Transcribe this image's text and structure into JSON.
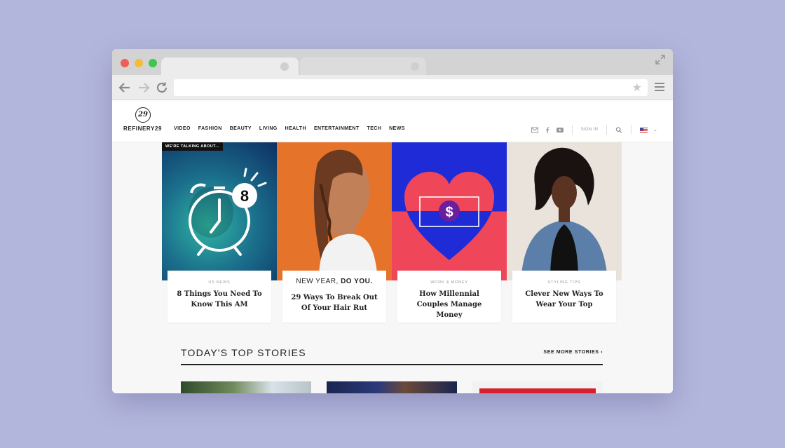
{
  "site": {
    "logo_mark": "29",
    "logo_text": "REFINERY29",
    "nav": [
      "VIDEO",
      "FASHION",
      "BEAUTY",
      "LIVING",
      "HEALTH",
      "ENTERTAINMENT",
      "TECH",
      "NEWS"
    ],
    "sign_in": "SIGN IN"
  },
  "hero": {
    "tag": "WE'RE TALKING ABOUT...",
    "alarm_number": "8",
    "heart_symbol": "$",
    "cards": [
      {
        "kicker": "US NEWS",
        "title": "8 Things You Need To Know This AM"
      },
      {
        "promo_a": "NEW YEAR, ",
        "promo_b": "DO YOU.",
        "title": "29 Ways To Break Out Of Your Hair Rut"
      },
      {
        "kicker": "WORK & MONEY",
        "title": "How Millennial Couples Manage Money"
      },
      {
        "kicker": "STYLING TIPS",
        "title": "Clever New Ways To Wear Your Top"
      }
    ]
  },
  "top_stories": {
    "title": "TODAY'S TOP STORIES",
    "see_more": "SEE MORE STORIES ›"
  },
  "colors": {
    "background": "#b3b6dc",
    "orange": "#e6732a",
    "blue": "#1e2bd6",
    "red": "#f0465a"
  }
}
